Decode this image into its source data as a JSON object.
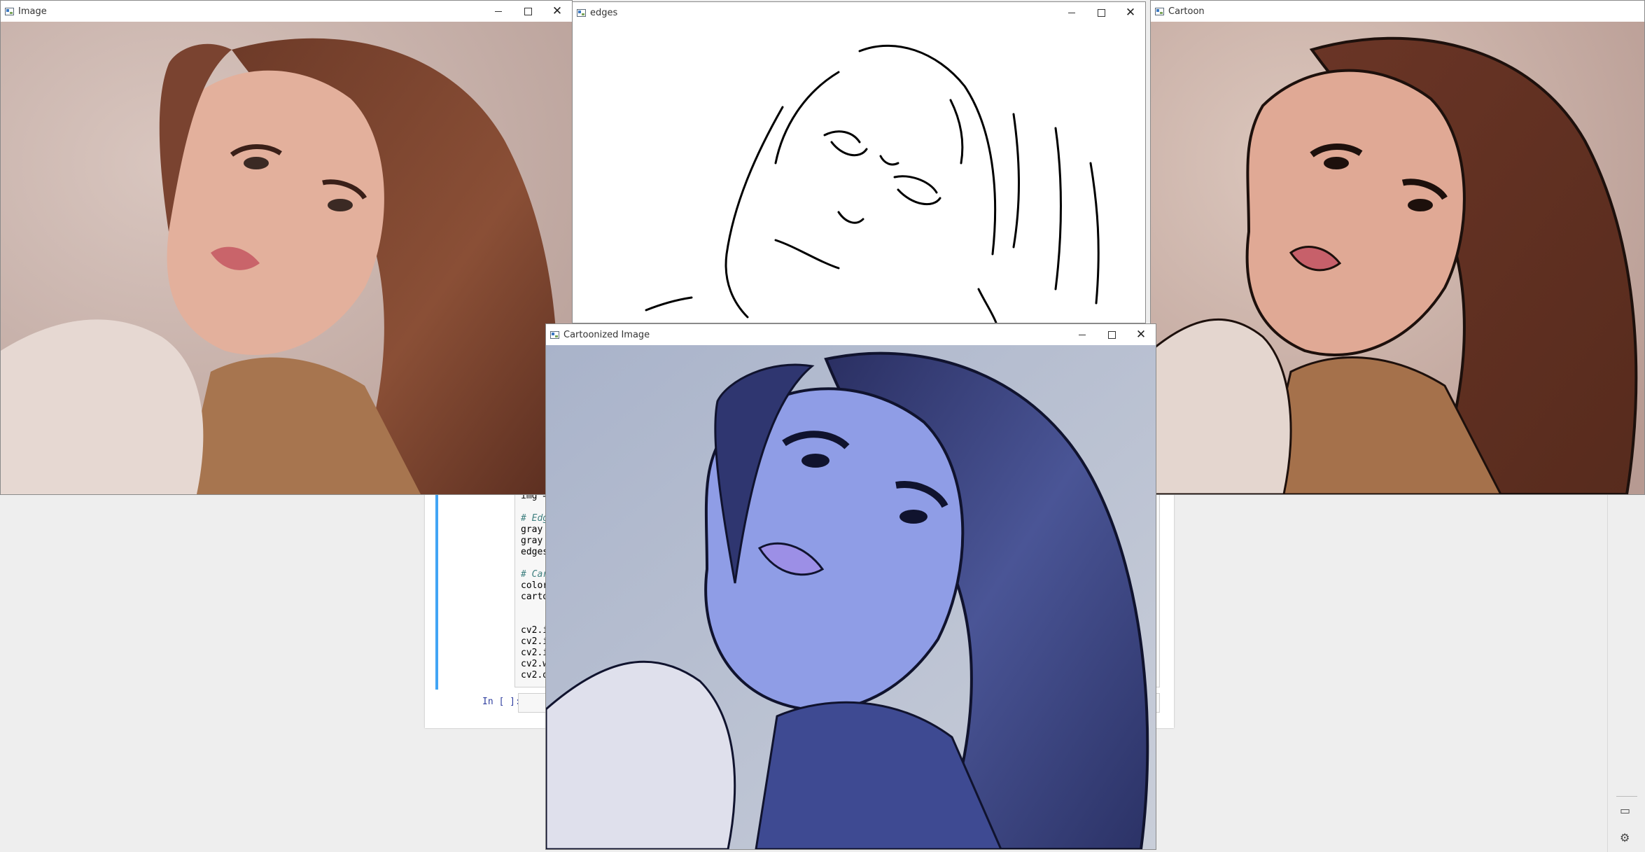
{
  "notebook": {
    "code_lines": [
      {
        "text": "img ="
      },
      {
        "text": ""
      },
      {
        "text": "# Edg",
        "comment": true
      },
      {
        "text": "gray"
      },
      {
        "text": "gray"
      },
      {
        "text": "edges"
      },
      {
        "text": ""
      },
      {
        "text": "# Car",
        "comment": true
      },
      {
        "text": "color"
      },
      {
        "text": "carto"
      },
      {
        "text": ""
      },
      {
        "text": ""
      },
      {
        "text": "cv2.i"
      },
      {
        "text": "cv2.i"
      },
      {
        "text": "cv2.i"
      },
      {
        "text": "cv2.w"
      },
      {
        "text": "cv2.d"
      }
    ],
    "prompt": "In [ ]:"
  },
  "windows": {
    "image": {
      "title": "Image"
    },
    "edges": {
      "title": "edges"
    },
    "cartoon": {
      "title": "Cartoon"
    },
    "cartoonized": {
      "title": "Cartoonized Image"
    }
  },
  "rail": {
    "icons": [
      "panel-icon",
      "gear-icon"
    ]
  },
  "colors": {
    "accent": "#42a5f5",
    "prompt": "#303f9f"
  }
}
